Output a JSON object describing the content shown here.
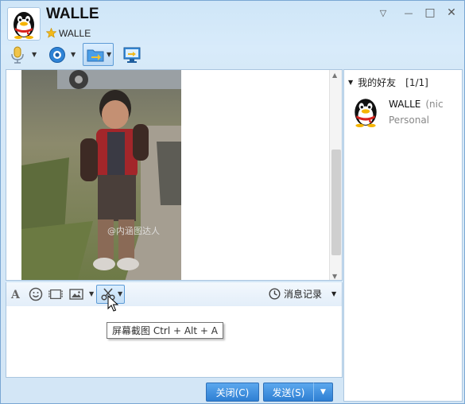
{
  "window": {
    "title": "WALLE",
    "subtitle": "WALLE",
    "controls": {
      "menu": "▽",
      "minimize": "—",
      "maximize": "□",
      "close": "✕"
    }
  },
  "toolbar_top": {
    "icons": [
      "microphone-icon",
      "video-call-icon",
      "file-transfer-icon",
      "remote-desktop-icon"
    ]
  },
  "chat": {
    "image_watermark": "@内涵图达人"
  },
  "input_toolbar": {
    "icons": [
      "font-icon",
      "emoji-icon",
      "video-icon",
      "image-icon",
      "screenshot-scissors-icon"
    ],
    "history_label": "消息记录"
  },
  "tooltip": {
    "text": "屏幕截图 Ctrl + Alt + A"
  },
  "buttons": {
    "close_label": "关闭(C)",
    "send_label": "发送(S)"
  },
  "friends_panel": {
    "group_label": "我的好友",
    "group_count": "[1/1]",
    "friend": {
      "name": "WALLE",
      "nick": "(nic",
      "signature": "Personal"
    }
  },
  "colors": {
    "accent": "#2f7fd3",
    "frame": "#d6e9f8",
    "border": "#aac6e0"
  }
}
